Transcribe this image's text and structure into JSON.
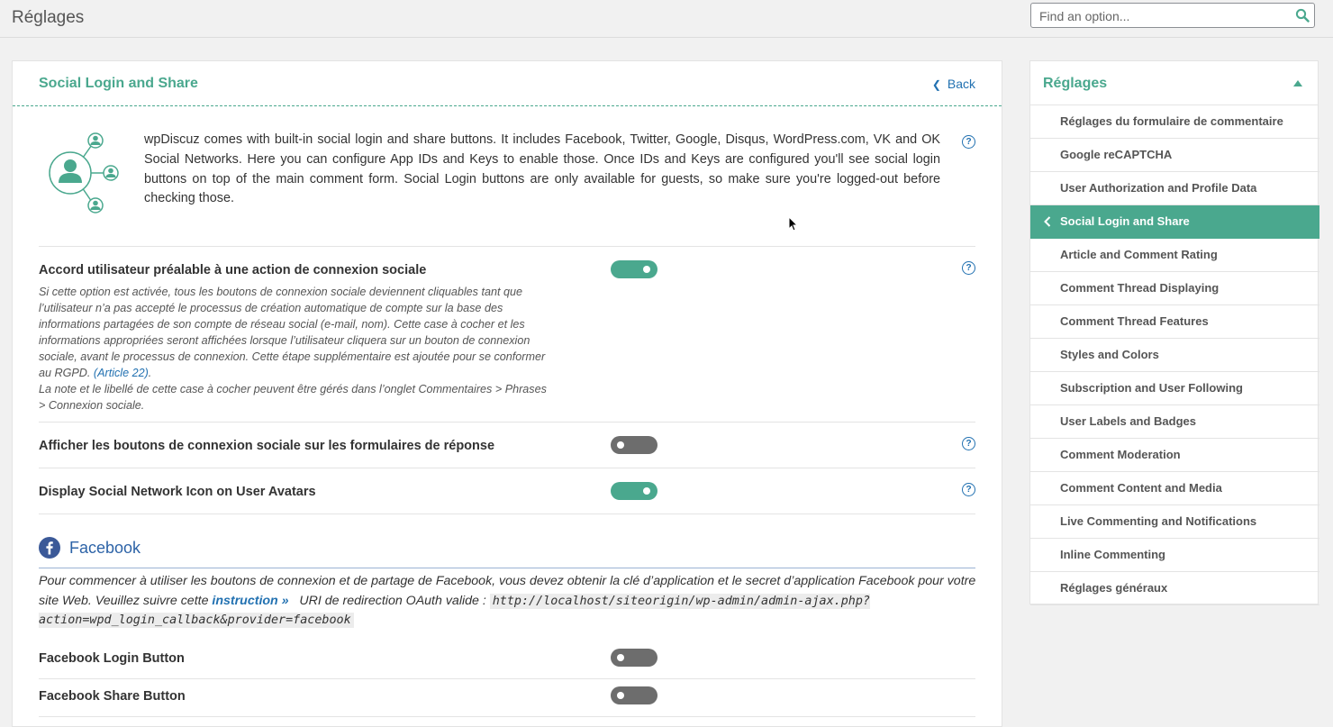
{
  "header": {
    "title": "Réglages",
    "search_placeholder": "Find an option..."
  },
  "panel": {
    "title": "Social Login and Share",
    "back_label": "Back",
    "intro": "wpDiscuz comes with built-in social login and share buttons. It includes Facebook, Twitter, Google, Disqus, WordPress.com, VK and OK Social Networks. Here you can configure App IDs and Keys to enable those. Once IDs and Keys are configured you'll see social login buttons on top of the main comment form. Social Login buttons are only available for guests, so make sure you're logged-out before checking those."
  },
  "options": [
    {
      "label": "Accord utilisateur préalable à une action de connexion sociale",
      "enabled": true,
      "desc_part1": "Si cette option est activée, tous les boutons de connexion sociale deviennent cliquables tant que l’utilisateur n’a pas accepté le processus de création automatique de compte sur la base des informations partagées de son compte de réseau social (e-mail, nom). Cette case à cocher et les informations appropriées seront affichées lorsque l’utilisateur cliquera sur un bouton de connexion sociale, avant le processus de connexion. Cette étape supplémentaire est ajoutée pour se conformer au RGPD.",
      "desc_link": "(Article 22)",
      "desc_part2": ".",
      "desc_part3": "La note et le libellé de cette case à cocher peuvent être gérés dans l’onglet Commentaires > Phrases > Connexion sociale."
    },
    {
      "label": "Afficher les boutons de connexion sociale sur les formulaires de réponse",
      "enabled": false
    },
    {
      "label": "Display Social Network Icon on User Avatars",
      "enabled": true
    }
  ],
  "facebook": {
    "title": "Facebook",
    "desc_part1": "Pour commencer à utiliser les boutons de connexion et de partage de Facebook, vous devez obtenir la clé d’application et le secret d’application Facebook pour votre site Web. Veuillez suivre cette",
    "link": "instruction »",
    "desc_part2": "URI de redirection OAuth valide :",
    "code": "http://localhost/siteorigin/wp-admin/admin-ajax.php?action=wpd_login_callback&provider=facebook",
    "options": [
      {
        "label": "Facebook Login Button",
        "enabled": false
      },
      {
        "label": "Facebook Share Button",
        "enabled": false
      }
    ]
  },
  "sidebar": {
    "title": "Réglages",
    "items": [
      {
        "label": "Réglages du formulaire de commentaire"
      },
      {
        "label": "Google reCAPTCHA"
      },
      {
        "label": "User Authorization and Profile Data"
      },
      {
        "label": "Social Login and Share",
        "active": true
      },
      {
        "label": "Article and Comment Rating"
      },
      {
        "label": "Comment Thread Displaying"
      },
      {
        "label": "Comment Thread Features"
      },
      {
        "label": "Styles and Colors"
      },
      {
        "label": "Subscription and User Following"
      },
      {
        "label": "User Labels and Badges"
      },
      {
        "label": "Comment Moderation"
      },
      {
        "label": "Comment Content and Media"
      },
      {
        "label": "Live Commenting and Notifications"
      },
      {
        "label": "Inline Commenting"
      },
      {
        "label": "Réglages généraux"
      }
    ]
  },
  "colors": {
    "accent": "#4aa88e",
    "link": "#2271b1",
    "facebook": "#3b5998",
    "toggle_off": "#6d6d6d"
  }
}
